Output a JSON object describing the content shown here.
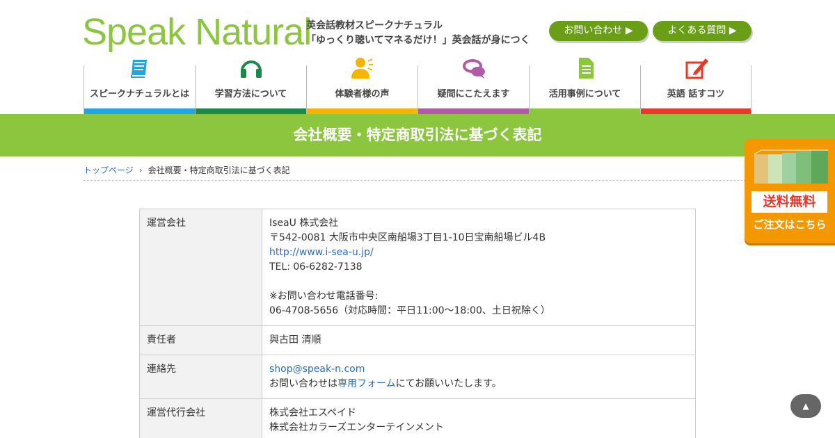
{
  "header": {
    "logo": "Speak Natural",
    "tagline_1": "英会話教材スピークナチュラル",
    "tagline_2": "「ゆっくり聴いてマネるだけ！」英会話が身につく",
    "contact_button": "お問い合わせ ▶",
    "faq_button": "よくある質問 ▶"
  },
  "nav": [
    {
      "label": "スピークナチュラルとは",
      "icon": "book-icon",
      "color": "#1ea6e6"
    },
    {
      "label": "学習方法について",
      "icon": "headphones-icon",
      "color": "#1a8a4a"
    },
    {
      "label": "体験者様の声",
      "icon": "user-voice-icon",
      "color": "#f5b400"
    },
    {
      "label": "疑問にこたえます",
      "icon": "chat-bubbles-icon",
      "color": "#b05aa8"
    },
    {
      "label": "活用事例について",
      "icon": "document-icon",
      "color": "#8cc63f"
    },
    {
      "label": "英語 話すコツ",
      "icon": "edit-icon",
      "color": "#e8382a"
    }
  ],
  "page_title": "会社概要・特定商取引法に基づく表記",
  "breadcrumb": {
    "home": "トップページ",
    "separator": "›",
    "current": "会社概要・特定商取引法に基づく表記"
  },
  "table": {
    "company_label": "運営会社",
    "company_name": "IseaU 株式会社",
    "company_address": "〒542-0081 大阪市中央区南船場3丁目1-10日宝南船場ビル4B",
    "company_url": "http://www.i-sea-u.jp/",
    "company_tel": "TEL: 06-6282-7138",
    "company_inquiry_label": "※お問い合わせ電話番号:",
    "company_inquiry_tel": "06-4708-5656（対応時間：平日11:00〜18:00、土日祝除く）",
    "manager_label": "責任者",
    "manager_name": "與古田 清順",
    "contact_label": "連絡先",
    "contact_email": "shop@speak-n.com",
    "contact_text_1": "お問い合わせは",
    "contact_link": "専用フォーム",
    "contact_text_2": "にてお願いいたします。",
    "agency_label": "運営代行会社",
    "agency_1": "株式会社エスペイド",
    "agency_2": "株式会社カラーズエンターテインメント"
  },
  "side_banner": {
    "free_shipping": "送料無料",
    "order_here": "ご注文はこちら"
  },
  "to_top": "▲"
}
